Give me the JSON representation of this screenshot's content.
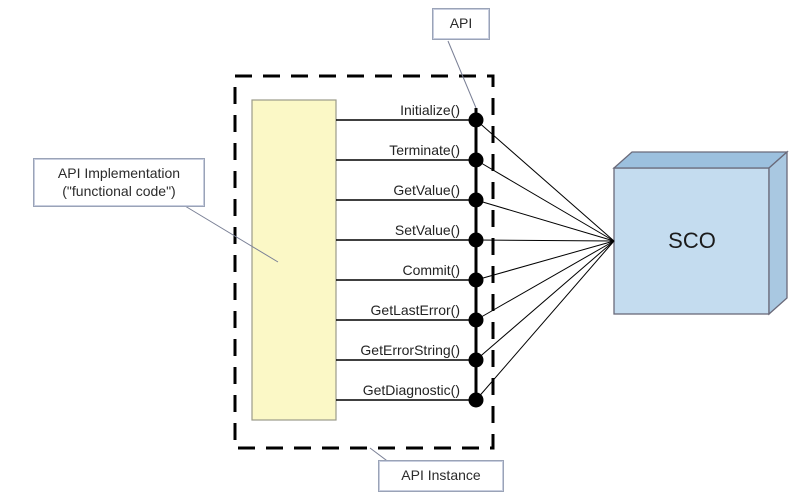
{
  "diagram": {
    "callouts": {
      "api": "API",
      "api_instance": "API Instance",
      "impl1": "API Implementation",
      "impl2": "(\"functional code\")"
    },
    "methods": [
      "Initialize()",
      "Terminate()",
      "GetValue()",
      "SetValue()",
      "Commit()",
      "GetLastError()",
      "GetErrorString()",
      "GetDiagnostic()"
    ],
    "sco": "SCO"
  }
}
